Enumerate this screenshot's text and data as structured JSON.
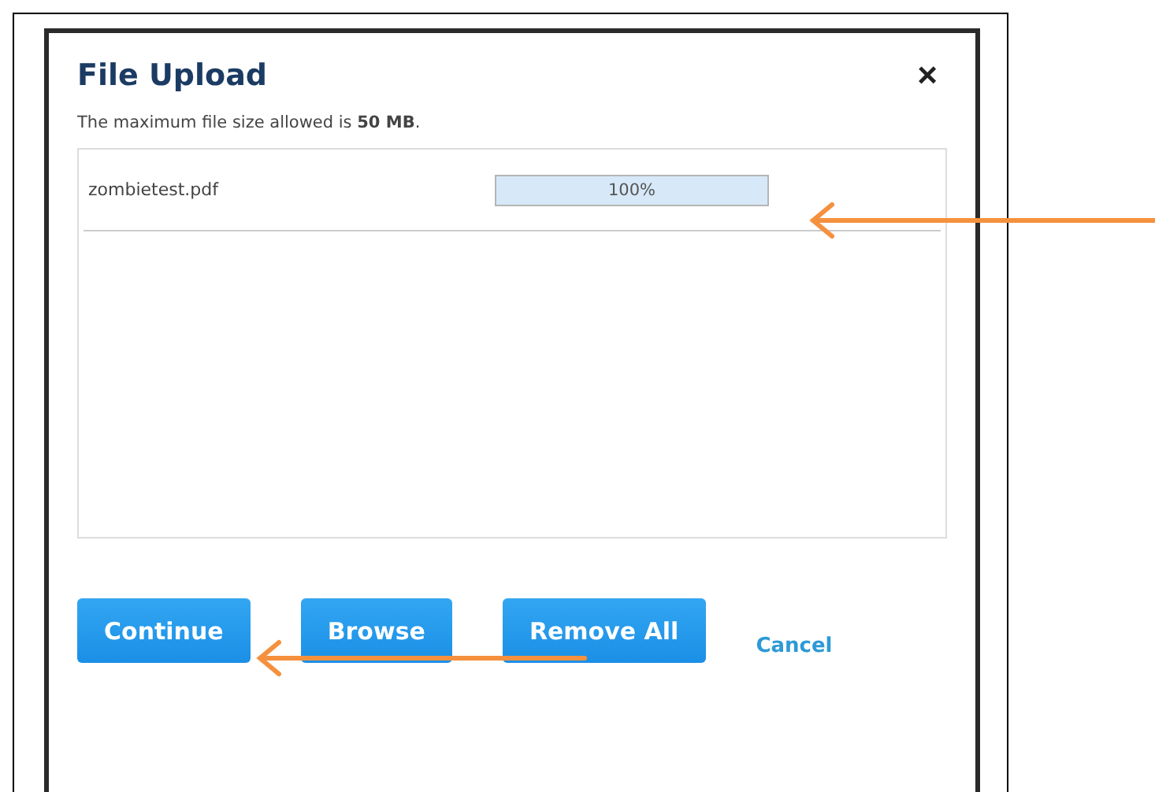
{
  "dialog": {
    "title": "File Upload",
    "close": "×",
    "size_note": "The maximum file size allowed is  **50 MB**.",
    "files": [
      {
        "name": "zombietest.pdf",
        "level": 1,
        "reading": "100%"
      }
    ],
    "buttons": [
      {
        "label": "Continue",
        "kind": "button"
      },
      {
        "label": "Browse",
        "kind": "button"
      },
      {
        "label": "Remove All",
        "kind": "button"
      },
      {
        "label": "Cancel",
        "kind": "link"
      }
    ]
  }
}
